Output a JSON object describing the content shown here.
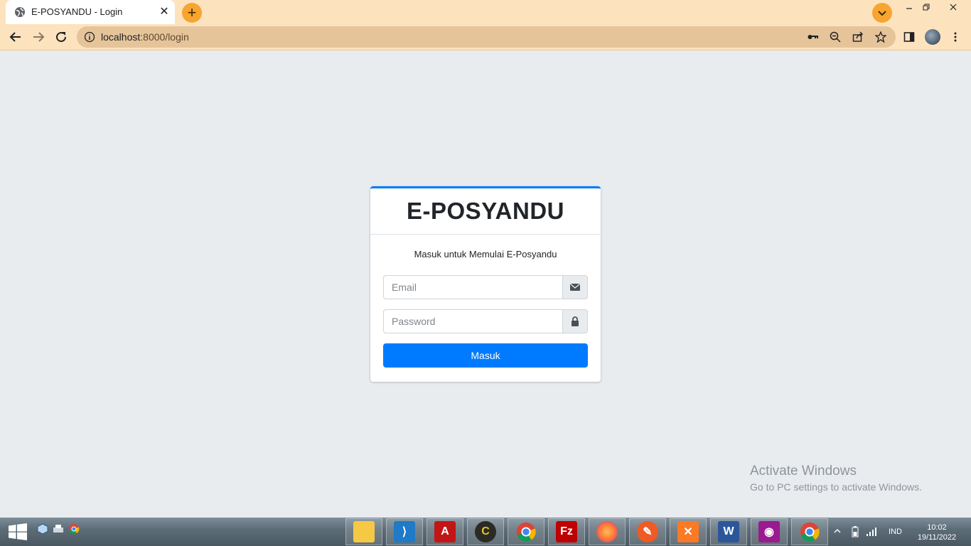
{
  "browser": {
    "tab_title": "E-POSYANDU - Login",
    "url_host": "localhost",
    "url_path": ":8000/login"
  },
  "login": {
    "brand": "E-POSYANDU",
    "message": "Masuk untuk Memulai E-Posyandu",
    "email_placeholder": "Email",
    "password_placeholder": "Password",
    "submit_label": "Masuk"
  },
  "watermark": {
    "title": "Activate Windows",
    "subtitle": "Go to PC settings to activate Windows."
  },
  "taskbar": {
    "apps": [
      "file-explorer",
      "vscode",
      "acrobat",
      "eclipse",
      "chrome",
      "filezilla",
      "firefox",
      "postman",
      "xampp",
      "word",
      "camera",
      "chrome-profile"
    ],
    "language": "IND",
    "time": "10:02",
    "date": "19/11/2022"
  },
  "colors": {
    "accent": "#007bff",
    "browser_frame": "#fde2be",
    "page_bg": "#e9ecef"
  }
}
